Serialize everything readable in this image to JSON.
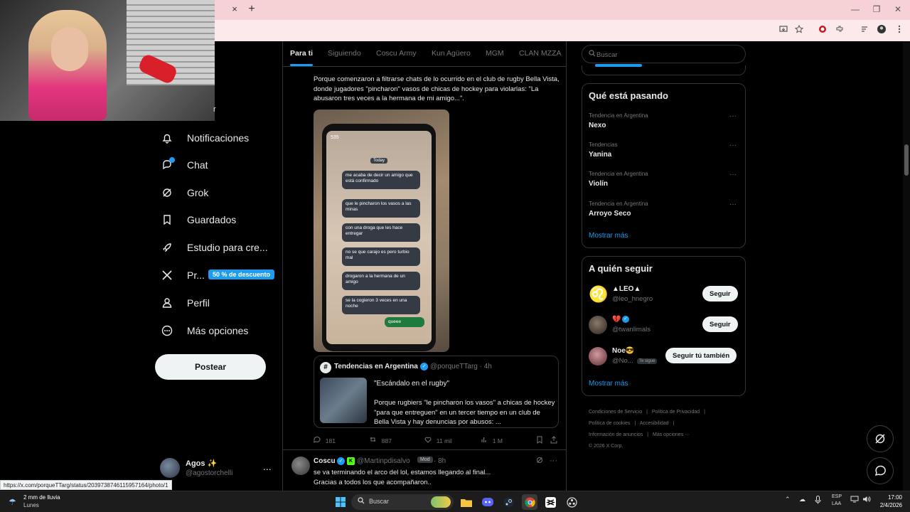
{
  "browser": {
    "tab_close": "×",
    "tab_new": "+",
    "window_controls": [
      "—",
      "❐",
      "✕"
    ]
  },
  "nav": {
    "items": [
      {
        "label": "Notificaciones",
        "icon": "bell-icon"
      },
      {
        "label": "Chat",
        "icon": "chat-icon"
      },
      {
        "label": "Grok",
        "icon": "grok-icon"
      },
      {
        "label": "Guardados",
        "icon": "bookmark-icon"
      },
      {
        "label": "Estudio para cre...",
        "icon": "rocket-icon"
      },
      {
        "label": "Pr...",
        "icon": "x-logo-icon"
      },
      {
        "label": "Perfil",
        "icon": "person-icon"
      },
      {
        "label": "Más opciones",
        "icon": "more-circle-icon"
      }
    ],
    "premium_badge": "50 % de descuento",
    "partial_label": "r",
    "post_button": "Postear"
  },
  "account": {
    "name": "Agos ✨",
    "handle": "@agostorchelli",
    "more": "..."
  },
  "status_url": "https://x.com/porqueTTarg/status/2039738746115957164/photo/1",
  "feed": {
    "tabs": [
      "Para ti",
      "Siguiendo",
      "Coscu Army",
      "Kun Agüero",
      "MGM",
      "CLAN MZZA"
    ],
    "active_tab": 0,
    "post": {
      "text": "Porque comenzaron a filtrarse chats de lo ocurrido en el club de rugby Bella Vista, donde jugadores \"pincharon\" vasos de chicas de hockey para violarlas: \"La abusaron tres veces a la hermana de mi amigo...\".",
      "chat_header": "535",
      "chat_today": "Today",
      "chat_bubbles": [
        "me acaba de decir un amigo que está confirmado",
        "que le pincharon los vasos a las minas",
        "con una droga que les hace entregar",
        "no se que carajo es pero turbio mal",
        "drogaron a la hermana de un amigo",
        "se la cogieron 3 veces en una noche"
      ],
      "chat_reply": "queee",
      "quote": {
        "name": "Tendencias en Argentina",
        "handle": "@porqueTTarg · 4h",
        "title": "\"Escándalo en el rugby\"",
        "body": "Porque rugbiers \"le pincharon los vasos\" a chicas de hockey \"para que entreguen\" en un tercer tiempo en un club de Bella Vista y hay denuncias por abusos: ..."
      },
      "actions": {
        "replies": "181",
        "reposts": "887",
        "likes": "11 mil",
        "views": "1 M"
      }
    },
    "post2": {
      "name": "Coscu",
      "handle": "@Martinpdisalvo",
      "mod": "Mod",
      "time": "· 8h",
      "text": "se va terminando el arco del lol, estamos llegando al final...\nGracias a todos los que acompañaron.."
    }
  },
  "search": {
    "placeholder": "Buscar"
  },
  "trends": {
    "title": "Qué está pasando",
    "items": [
      {
        "context": "Tendencia en Argentina",
        "name": "Nexo"
      },
      {
        "context": "Tendencias",
        "name": "Yanina"
      },
      {
        "context": "Tendencia en Argentina",
        "name": "Violín"
      },
      {
        "context": "Tendencia en Argentina",
        "name": "Arroyo Seco"
      }
    ],
    "more_dots": "···",
    "show_more": "Mostrar más"
  },
  "who_to_follow": {
    "title": "A quién seguir",
    "items": [
      {
        "name": "▲LEO▲",
        "handle": "@leo_hnegro",
        "button": "Seguir",
        "follows_you": ""
      },
      {
        "name": "💔",
        "handle": "@twanlimals",
        "button": "Seguir",
        "follows_you": ""
      },
      {
        "name": "Noe😎",
        "handle": "@No...",
        "button": "Seguir tú también",
        "follows_you": "Te sigue"
      }
    ],
    "show_more": "Mostrar más"
  },
  "footer": {
    "links": [
      "Condiciones de Servicio",
      "|",
      "Política de Privacidad",
      "|",
      "Política de cookies",
      "|",
      "Accesibilidad",
      "|",
      "Información de anuncios",
      "|",
      "Más opciones ···"
    ],
    "copyright": "© 2026 X Corp."
  },
  "taskbar": {
    "weather_line1": "2 mm de lluvia",
    "weather_line2": "Lunes",
    "search_placeholder": "Buscar",
    "lang_line1": "ESP",
    "lang_line2": "LAA",
    "time": "17:00",
    "date": "2/4/2026"
  },
  "colors": {
    "accent": "#1d9bf0",
    "background": "#000000",
    "border": "#2f3336",
    "muted": "#71767b",
    "tabbar": "#f6d2d6"
  }
}
